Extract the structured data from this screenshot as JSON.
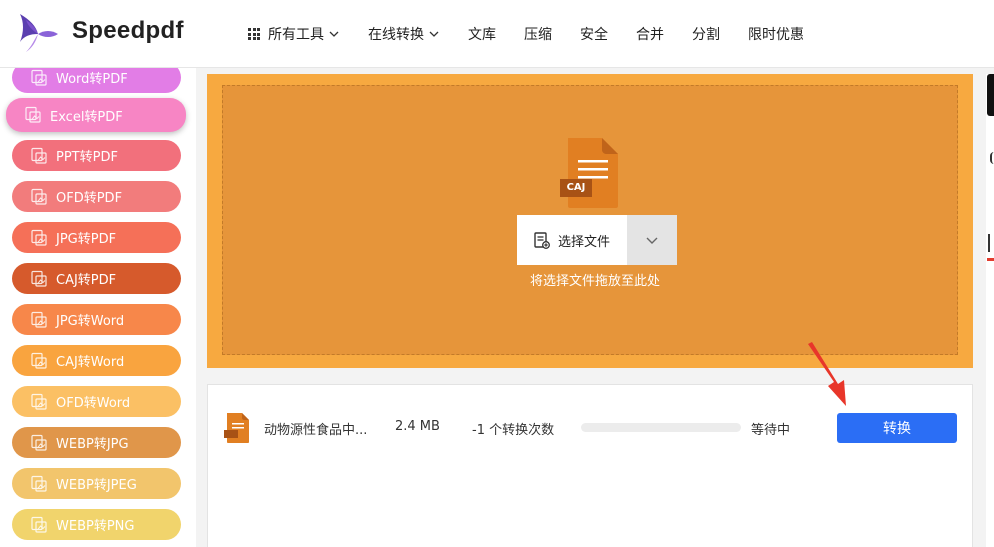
{
  "app": {
    "brand": "Speedpdf"
  },
  "nav": {
    "items": [
      {
        "label": "所有工具",
        "has_grid": true,
        "has_dropdown": true
      },
      {
        "label": "在线转换",
        "has_grid": false,
        "has_dropdown": true
      },
      {
        "label": "文库",
        "has_grid": false,
        "has_dropdown": false
      },
      {
        "label": "压缩",
        "has_grid": false,
        "has_dropdown": false
      },
      {
        "label": "安全",
        "has_grid": false,
        "has_dropdown": false
      },
      {
        "label": "合并",
        "has_grid": false,
        "has_dropdown": false
      },
      {
        "label": "分割",
        "has_grid": false,
        "has_dropdown": false
      },
      {
        "label": "限时优惠",
        "has_grid": false,
        "has_dropdown": false
      }
    ]
  },
  "sidebar": {
    "items": [
      {
        "label": "Word转PDF",
        "color": "#e27de6"
      },
      {
        "label": "Excel转PDF",
        "color": "#f785c4",
        "active": true
      },
      {
        "label": "PPT转PDF",
        "color": "#f2707c"
      },
      {
        "label": "OFD转PDF",
        "color": "#f27c7c"
      },
      {
        "label": "JPG转PDF",
        "color": "#f57058"
      },
      {
        "label": "CAJ转PDF",
        "color": "#d65a2c"
      },
      {
        "label": "JPG转Word",
        "color": "#f7874a"
      },
      {
        "label": "CAJ转Word",
        "color": "#f9a43f"
      },
      {
        "label": "OFD转Word",
        "color": "#fbc064"
      },
      {
        "label": "WEBP转JPG",
        "color": "#e0964a"
      },
      {
        "label": "WEBP转JPEG",
        "color": "#f2c56c"
      },
      {
        "label": "WEBP转PNG",
        "color": "#f1d46c"
      }
    ]
  },
  "upload": {
    "file_type_label": "CAJ",
    "select_label": "选择文件",
    "hint": "将选择文件拖放至此处"
  },
  "file_row": {
    "name": "动物源性食品中...",
    "size": "2.4 MB",
    "count": "-1 个转换次数",
    "progress": 0,
    "status": "等待中",
    "convert_label": "转换"
  },
  "colors": {
    "accent": "#2b6ef5",
    "upload_outer": "#f7a940",
    "upload_inner": "#e6953a",
    "file_icon": "#e17f22",
    "arrow": "#e8362a"
  }
}
